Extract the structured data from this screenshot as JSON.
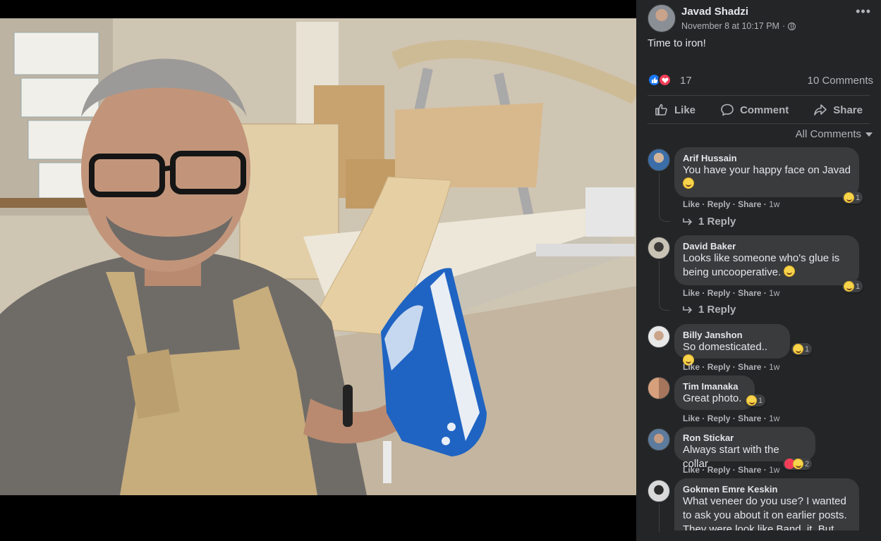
{
  "post": {
    "author": "Javad Shadzi",
    "timestamp": "November 8 at 10:17 PM",
    "separator": "·",
    "privacy_icon": "globe-icon",
    "caption": "Time to iron!",
    "reaction_count": "17",
    "comment_count": "10 Comments",
    "reaction_types": [
      "like",
      "love"
    ]
  },
  "actions": {
    "like": "Like",
    "comment": "Comment",
    "share": "Share"
  },
  "filter_label": "All Comments",
  "comment_actions": {
    "like": "Like",
    "reply": "Reply",
    "share": "Share",
    "sep": "·"
  },
  "comments": [
    {
      "name": "Arif Hussain",
      "text": "You have your happy face on Javad",
      "time": "1w",
      "reaction_count": "1",
      "replies": "1 Reply"
    },
    {
      "name": "David Baker",
      "text": "Looks like someone who's glue is being uncooperative.",
      "time": "1w",
      "reaction_count": "1",
      "replies": "1 Reply"
    },
    {
      "name": "Billy Janshon",
      "text": "So domesticated..",
      "time": "1w",
      "reaction_count": "1"
    },
    {
      "name": "Tim Imanaka",
      "text": "Great photo.",
      "time": "1w",
      "reaction_count": "1"
    },
    {
      "name": "Ron Stickar",
      "text": "Always start with the collar",
      "time": "1w",
      "reaction_count": "2"
    },
    {
      "name": "Gokmen Emre Keskin",
      "text": "What veneer do you use? I wanted to ask you about it on earlier posts. They were look like Band. it. But"
    }
  ],
  "colors": {
    "panel_bg": "#242526",
    "bubble_bg": "#3a3b3c",
    "like_blue": "#1877f2",
    "love_red": "#f33e58",
    "secondary_text": "#b0b3b8",
    "primary_text": "#e4e6eb"
  }
}
